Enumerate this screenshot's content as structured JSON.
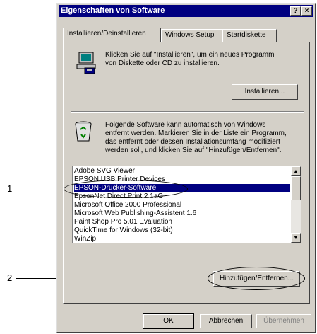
{
  "window": {
    "title": "Eigenschaften von Software",
    "help_button": "?",
    "close_button": "×"
  },
  "tabs": [
    {
      "label": "Installieren/Deinstallieren"
    },
    {
      "label": "Windows Setup"
    },
    {
      "label": "Startdiskette"
    }
  ],
  "install": {
    "description": "Klicken Sie auf \"Installieren\", um ein neues Programm von Diskette oder CD zu installieren.",
    "line1": "Klicken Sie auf \"Installieren\", um ein neues Programm",
    "line2": "von Diskette oder CD zu installieren.",
    "button_label": "Installieren..."
  },
  "uninstall": {
    "line1": "Folgende Software kann automatisch von Windows",
    "line2": "entfernt werden. Markieren Sie in der Liste ein Programm,",
    "line3": "das entfernt oder dessen Installationsumfang modifiziert",
    "line4": "werden soll, und klicken Sie auf \"Hinzufügen/Entfernen\".",
    "button_label": "Hinzufügen/Entfernen..."
  },
  "software_list": [
    {
      "name": "Adobe SVG Viewer",
      "selected": false
    },
    {
      "name": "EPSON USB Printer Devices",
      "selected": false
    },
    {
      "name": "EPSON-Drucker-Software",
      "selected": true
    },
    {
      "name": "EpsonNet Direct Print 2.1aG",
      "selected": false
    },
    {
      "name": "Microsoft Office 2000 Professional",
      "selected": false
    },
    {
      "name": "Microsoft Web Publishing-Assistent 1.6",
      "selected": false
    },
    {
      "name": "Paint Shop Pro 5.01 Evaluation",
      "selected": false
    },
    {
      "name": "QuickTime for Windows (32-bit)",
      "selected": false
    },
    {
      "name": "WinZip",
      "selected": false
    }
  ],
  "footer": {
    "ok_label": "OK",
    "cancel_label": "Abbrechen",
    "apply_label": "Übernehmen"
  },
  "callouts": {
    "label1": "1",
    "label2": "2"
  },
  "colors": {
    "titlebar": "#000080",
    "selection": "#000080",
    "face": "#d4d0c8"
  }
}
